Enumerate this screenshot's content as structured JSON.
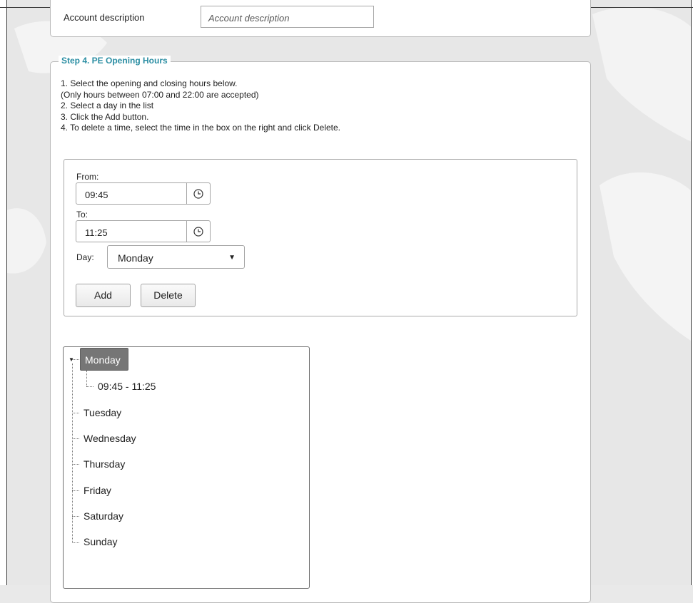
{
  "account": {
    "description_label": "Account description",
    "description_placeholder": "Account description"
  },
  "step4": {
    "title": "Step 4. PE Opening Hours",
    "instructions": [
      "1. Select the opening and closing hours below.",
      "(Only hours between 07:00 and 22:00 are accepted)",
      "2. Select a day in the list",
      "3. Click the Add button.",
      "4. To delete a time, select the time in the box on the right and click Delete."
    ],
    "from_label": "From:",
    "from_value": "09:45",
    "to_label": "To:",
    "to_value": "11:25",
    "day_label": "Day:",
    "day_selected": "Monday",
    "add_label": "Add",
    "delete_label": "Delete"
  },
  "tree": {
    "selected_day": "Monday",
    "monday_slot": "09:45 - 11:25",
    "days": [
      "Tuesday",
      "Wednesday",
      "Thursday",
      "Friday",
      "Saturday",
      "Sunday"
    ]
  },
  "icons": {
    "clock": "clock-icon",
    "dropdown": "chevron-down-icon",
    "expand": "expand-triangle-icon"
  }
}
